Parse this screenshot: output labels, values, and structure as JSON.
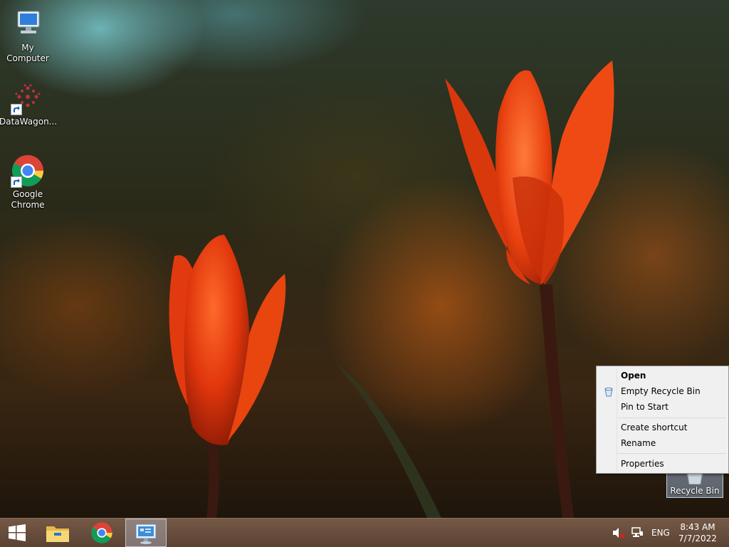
{
  "desktop": {
    "icons": [
      {
        "label": "My Computer",
        "icon": "computer-icon",
        "shortcut": false
      },
      {
        "label": "DataWagon...",
        "icon": "datawagon-icon",
        "shortcut": true
      },
      {
        "label": "Google Chrome",
        "icon": "chrome-icon",
        "shortcut": true
      }
    ],
    "recycle_bin": {
      "label": "Recycle Bin",
      "icon": "recycle-bin-icon",
      "selected": true
    }
  },
  "context_menu": {
    "items": [
      {
        "label": "Open",
        "bold": true
      },
      {
        "label": "Empty Recycle Bin",
        "icon": "recycle-bin-small-icon"
      },
      {
        "label": "Pin to Start"
      },
      {
        "label": "Create shortcut"
      },
      {
        "label": "Rename"
      },
      {
        "label": "Properties"
      }
    ]
  },
  "taskbar": {
    "start": {
      "icon": "windows-logo-icon"
    },
    "pinned": [
      {
        "name": "File Explorer",
        "icon": "file-explorer-icon"
      },
      {
        "name": "Google Chrome",
        "icon": "chrome-icon"
      },
      {
        "name": "Remote Desktop",
        "icon": "remote-desktop-icon",
        "active": true
      }
    ],
    "tray": {
      "volume_icon": "volume-muted-icon",
      "network_icon": "network-icon",
      "language": "ENG",
      "time": "8:43 AM",
      "date": "7/7/2022"
    }
  },
  "colors": {
    "menu_bg": "#f0f0f0",
    "taskbar": "#5f4230",
    "selection": "#aac8e6"
  }
}
